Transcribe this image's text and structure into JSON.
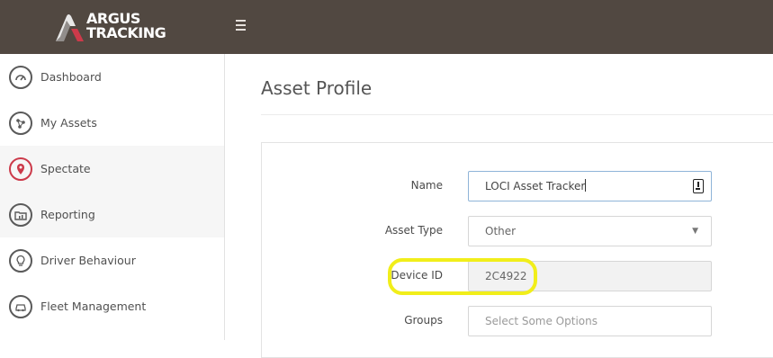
{
  "brand": {
    "line1": "ARGUS",
    "line2": "TRACKING",
    "accent": "#cc3a4a"
  },
  "header": {
    "menu_icon": "hamburger-icon",
    "bg": "#514841"
  },
  "sidebar": {
    "items": [
      {
        "label": "Dashboard",
        "icon": "gauge-icon"
      },
      {
        "label": "My Assets",
        "icon": "network-icon"
      },
      {
        "label": "Spectate",
        "icon": "map-pin-icon",
        "active": true
      },
      {
        "label": "Reporting",
        "icon": "folder-chart-icon"
      },
      {
        "label": "Driver Behaviour",
        "icon": "lightbulb-icon"
      },
      {
        "label": "Fleet Management",
        "icon": "car-icon"
      }
    ]
  },
  "main": {
    "title": "Asset Profile",
    "form": {
      "name": {
        "label": "Name",
        "value": "LOCI Asset Tracker"
      },
      "asset_type": {
        "label": "Asset Type",
        "value": "Other"
      },
      "device_id": {
        "label": "Device ID",
        "value": "2C4922"
      },
      "groups": {
        "label": "Groups",
        "placeholder": "Select Some Options"
      }
    }
  },
  "highlight_color": "#f1ee1a"
}
